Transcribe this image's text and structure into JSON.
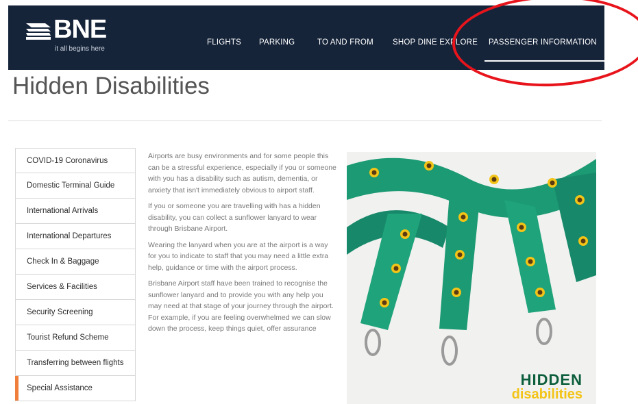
{
  "brand": {
    "logo_text": "BNE",
    "tagline": "it all begins here"
  },
  "nav": [
    {
      "label": "FLIGHTS"
    },
    {
      "label": "PARKING"
    },
    {
      "label": "TO AND FROM"
    },
    {
      "label": "SHOP DINE EXPLORE"
    },
    {
      "label": "PASSENGER INFORMATION",
      "active": true
    }
  ],
  "page_title": "Hidden Disabilities",
  "sidebar": {
    "items": [
      {
        "label": "COVID-19 Coronavirus"
      },
      {
        "label": "Domestic Terminal Guide"
      },
      {
        "label": "International Arrivals"
      },
      {
        "label": "International Departures"
      },
      {
        "label": "Check In & Baggage"
      },
      {
        "label": "Services & Facilities"
      },
      {
        "label": "Security Screening"
      },
      {
        "label": "Tourist Refund Scheme"
      },
      {
        "label": "Transferring between flights"
      },
      {
        "label": "Special Assistance",
        "active": true
      }
    ]
  },
  "content": {
    "paragraphs": [
      "Airports are busy environments and for some people this can be a stressful experience, especially if you or someone with you has a disability such as autism, dementia, or anxiety that isn't immediately obvious to airport staff.",
      "If you or someone you are travelling with has a hidden disability, you can collect a sunflower lanyard to wear through Brisbane Airport.",
      "Wearing the lanyard when you are at the airport is a way for you to indicate to staff that you may need a little extra help, guidance or time with the airport process.",
      "Brisbane Airport staff have been trained to recognise the sunflower lanyard and to provide you with any help you may need at that stage of your journey through the airport. For example, if you are feeling overwhelmed we can slow down the process, keep things quiet, offer assurance"
    ]
  },
  "hero": {
    "brand_line1": "HIDDEN",
    "brand_line2": "disabilities"
  },
  "colors": {
    "header_bg": "#16243a",
    "active_accent": "#f07f3c",
    "annotation_red": "#e8141b",
    "lanyard_green": "#1c9a73",
    "sunflower_yellow": "#f3c417"
  },
  "annotation": {
    "shape": "red-ellipse",
    "target": "PASSENGER INFORMATION"
  }
}
